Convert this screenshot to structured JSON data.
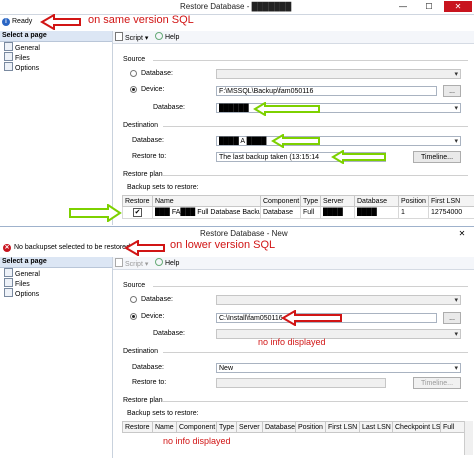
{
  "top": {
    "title": "Restore Database - ███████",
    "status": "Ready",
    "annotation": "on same version SQL",
    "pages_header": "Select a page",
    "pages": [
      "General",
      "Files",
      "Options"
    ],
    "toolbar": {
      "script": "Script",
      "help": "Help"
    },
    "source_label": "Source",
    "database_label": "Database:",
    "device_label": "Device:",
    "device_value": "F:\\MSSQL\\Backup\\fam050116",
    "browse_label": "...",
    "database_value_label": "Database:",
    "database_value": "██████",
    "destination_label": "Destination",
    "dest_database_label": "Database:",
    "dest_database_value": "████ A ████",
    "restore_to_label": "Restore to:",
    "restore_to_value": "The last backup taken (13:15:14",
    "timeline_label": "Timeline...",
    "restore_plan_label": "Restore plan",
    "backup_sets_label": "Backup sets to restore:",
    "columns": [
      "Restore",
      "Name",
      "Component",
      "Type",
      "Server",
      "Database",
      "Position",
      "First LSN"
    ],
    "rows": [
      {
        "restore": "✔",
        "name": "███ FA███ Full Database Backup",
        "component": "Database",
        "type": "Full",
        "server": "████",
        "database": "████",
        "position": "1",
        "first_lsn": "12754000"
      }
    ]
  },
  "bottom": {
    "title": "Restore Database - New",
    "status": "No backupset selected to be restored.",
    "annotation": "on lower version SQL",
    "pages_header": "Select a page",
    "pages": [
      "General",
      "Files",
      "Options"
    ],
    "toolbar": {
      "script": "Script",
      "help": "Help"
    },
    "source_label": "Source",
    "database_label": "Database:",
    "device_label": "Device:",
    "device_value": "C:\\Install\\fam050116",
    "browse_label": "...",
    "database_value_label": "Database:",
    "no_info_1": "no info displayed",
    "destination_label": "Destination",
    "dest_database_label": "Database:",
    "dest_database_value": "New",
    "restore_to_label": "Restore to:",
    "restore_to_value": "",
    "timeline_label": "Timeline...",
    "restore_plan_label": "Restore plan",
    "backup_sets_label": "Backup sets to restore:",
    "columns": [
      "Restore",
      "Name",
      "Component",
      "Type",
      "Server",
      "Database",
      "Position",
      "First LSN",
      "Last LSN",
      "Checkpoint LSN",
      "Full"
    ],
    "no_info_2": "no info displayed"
  },
  "colors": {
    "annotation_red": "#d11515",
    "highlight_green": "#7dd100",
    "info_blue": "#2a66c4",
    "error_red": "#c8141e"
  },
  "window_buttons": [
    "—",
    "☐",
    "✕"
  ]
}
